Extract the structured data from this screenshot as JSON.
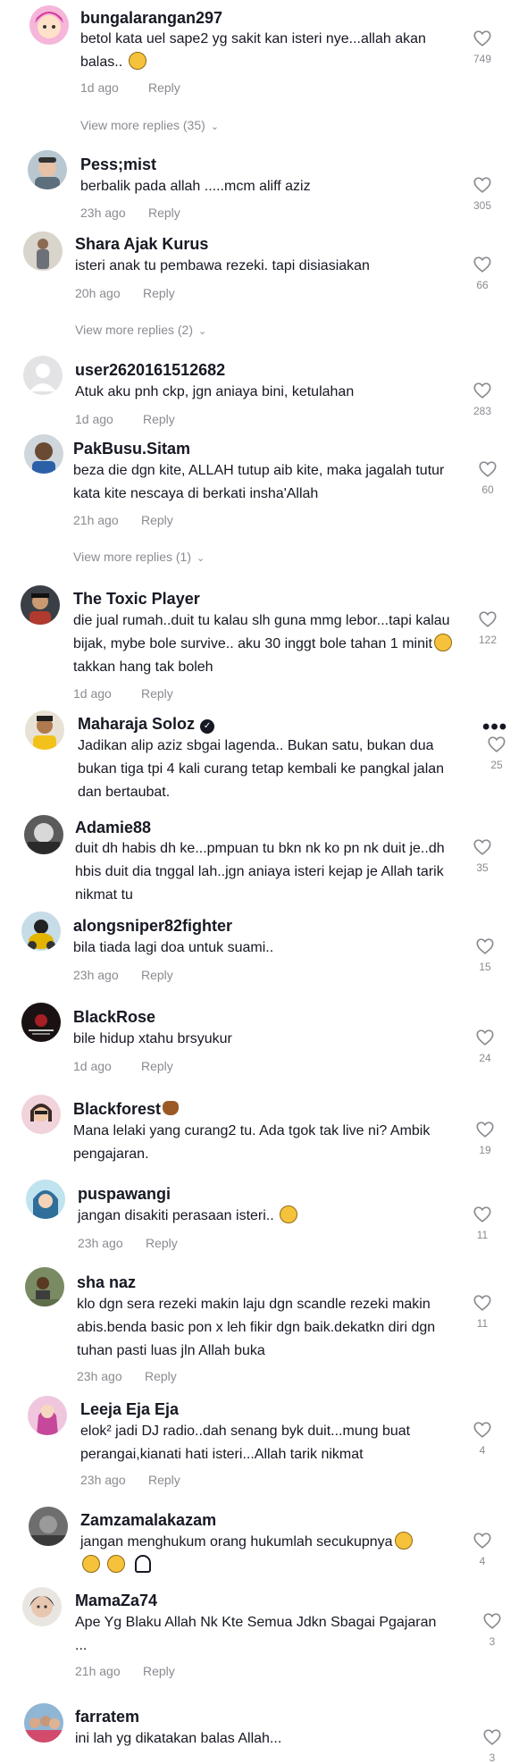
{
  "labels": {
    "reply": "Reply",
    "more_options": "•••"
  },
  "comments": [
    {
      "username": "bungalarangan297",
      "text": "betol kata uel sape2 yg sakit kan isteri nye...allah akan balas..",
      "time": "1d ago",
      "likes": "749",
      "avatar": "pink-cartoon",
      "replies_label": "View more replies (35)"
    },
    {
      "username": "Pess;mist",
      "text": "berbalik pada allah .....mcm aliff aziz",
      "time": "23h ago",
      "likes": "305",
      "avatar": "selfie"
    },
    {
      "username": "Shara Ajak Kurus",
      "text": "isteri anak tu pembawa rezeki. tapi disiasiakan",
      "time": "20h ago",
      "likes": "66",
      "avatar": "person-standing",
      "replies_label": "View more replies (2)"
    },
    {
      "username": "user2620161512682",
      "text": "Atuk aku pnh ckp, jgn aniaya bini, ketulahan",
      "time": "1d ago",
      "likes": "283",
      "avatar": "default"
    },
    {
      "username": "PakBusu.Sitam",
      "text": "beza die dgn kite, ALLAH tutup aib kite, maka jagalah tutur kata kite nescaya di berkati insha'Allah",
      "time": "21h ago",
      "likes": "60",
      "avatar": "man-portrait",
      "replies_label": "View more replies (1)"
    },
    {
      "username": "The Toxic Player",
      "text": "die jual rumah..duit tu kalau slh guna mmg lebor...tapi kalau bijak, mybe bole survive.. aku 30 inggt bole tahan 1 minit",
      "text_after": " takkan hang tak boleh",
      "time": "1d ago",
      "likes": "122",
      "avatar": "gamer"
    },
    {
      "username": "Maharaja Soloz",
      "text": "Jadikan alip aziz sbgai lagenda.. Bukan satu, bukan dua bukan tiga tpi 4 kali curang tetap kembali ke pangkal jalan dan bertaubat.",
      "time": "",
      "likes": "25",
      "avatar": "yellow-man",
      "verified": "✓"
    },
    {
      "username": "Adamie88",
      "text": "duit dh habis dh ke...pmpuan tu bkn nk ko pn nk duit je..dh hbis duit dia tnggal lah..jgn aniaya isteri kejap je Allah tarik nikmat tu",
      "time": "",
      "likes": "35",
      "avatar": "bw-photo"
    },
    {
      "username": "alongsniper82fighter",
      "text": "bila tiada lagi doa untuk suami..",
      "time": "23h ago",
      "likes": "15",
      "avatar": "rider"
    },
    {
      "username": "BlackRose",
      "text": "bile hidup xtahu brsyukur",
      "time": "1d ago",
      "likes": "24",
      "avatar": "dark-logo"
    },
    {
      "username": "Blackforest",
      "text": "Mana lelaki yang curang2 tu. Ada tgok tak live ni? Ambik pengajaran.",
      "time": "",
      "likes": "19",
      "avatar": "pink-girl"
    },
    {
      "username": "puspawangi",
      "text": "jangan disakiti perasaan isteri..",
      "time": "23h ago",
      "likes": "11",
      "avatar": "hijab-cartoon"
    },
    {
      "username": "sha naz",
      "text": "klo dgn sera rezeki makin laju dgn scandle rezeki makin abis.benda basic pon x leh fikir dgn baik.dekatkn diri dgn tuhan pasti luas jln Allah buka",
      "time": "23h ago",
      "likes": "11",
      "avatar": "outdoor"
    },
    {
      "username": "Leeja Eja Eja",
      "text": "elok² jadi DJ radio..dah senang byk duit...mung buat perangai,kianati hati isteri...Allah tarik nikmat",
      "time": "23h ago",
      "likes": "4",
      "avatar": "pink-lady"
    },
    {
      "username": "Zamzamalakazam",
      "text": "jangan menghukum orang hukumlah secukupnya",
      "time": "",
      "likes": "4",
      "avatar": "grey-photo"
    },
    {
      "username": "MamaZa74",
      "text": "Ape Yg Blaku Allah Nk Kte Semua Jdkn Sbagai Pgajaran ...",
      "time": "21h ago",
      "likes": "3",
      "avatar": "woman-face"
    },
    {
      "username": "farratem",
      "text": "ini lah yg dikatakan balas Allah...",
      "time": "",
      "likes": "3",
      "avatar": "group-photo"
    }
  ],
  "colors": {
    "text": "#161823",
    "secondary": "#8a8b91",
    "background": "#ffffff"
  }
}
